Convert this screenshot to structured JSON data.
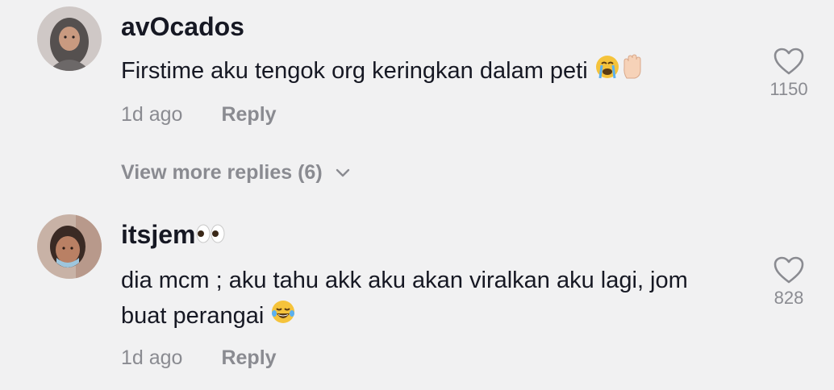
{
  "comments": [
    {
      "username": "avOcados",
      "text": "Firstime aku tengok org keringkan dalam peti",
      "timestamp": "1d ago",
      "reply_label": "Reply",
      "like_count": "1150",
      "view_more": "View more replies (6)"
    },
    {
      "username": "itsjem",
      "text_line1": "dia mcm ; aku tahu akk aku akan viralkan aku lagi, jom",
      "text_line2": "buat perangai",
      "timestamp": "1d ago",
      "reply_label": "Reply",
      "like_count": "828"
    }
  ],
  "icons": {
    "like": "heart-outline-icon",
    "expand": "chevron-down-icon",
    "crying_emoji": "loudly-crying-face-icon",
    "hand_emoji": "raised-hand-icon",
    "eyes_emoji": "eyes-icon",
    "laughing_emoji": "tears-of-joy-face-icon"
  },
  "colors": {
    "background": "#f1f1f2",
    "primary_text": "#161823",
    "secondary_text": "#8a8b91"
  }
}
